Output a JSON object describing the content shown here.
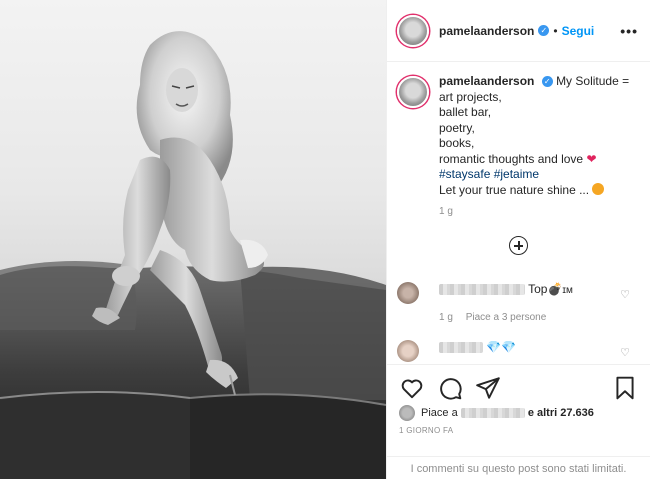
{
  "post": {
    "username": "pamelaanderson",
    "follow_label": "Segui",
    "more_label": "•••",
    "caption_lines": [
      "My Solitude =",
      "art projects,",
      "ballet bar,",
      "poetry,",
      "books,",
      "romantic thoughts and love"
    ],
    "hashtags": "#staysafe #jetaime",
    "last_line": "Let your true nature shine ...",
    "caption_time": "1 g",
    "accent_color": "#0095f6",
    "verified_icon": "verified-badge-icon"
  },
  "comments": [
    {
      "text": "Top💣",
      "suffix": "ɪᴍ",
      "time": "1 g",
      "likes": "Piace a 3 persone"
    },
    {
      "text": "💎💎"
    }
  ],
  "actions": {
    "icons": [
      "heart-icon",
      "comment-icon",
      "share-icon",
      "bookmark-icon"
    ],
    "likes_prefix": "Piace a",
    "likes_suffix": "e altri 27.636",
    "date": "1 GIORNO FA",
    "limited_notice": "I commenti su questo post sono stati limitati."
  }
}
